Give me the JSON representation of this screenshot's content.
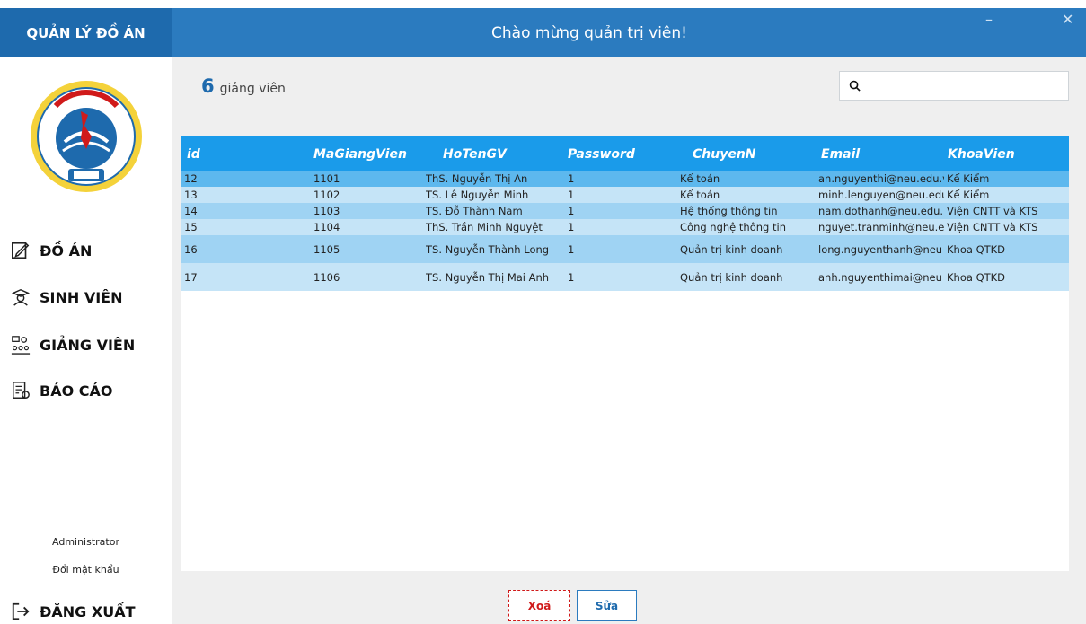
{
  "app": {
    "brand": "QUẢN LÝ ĐỒ ÁN",
    "welcome": "Chào mừng quản trị viên!",
    "minimize": "–",
    "close": "✕"
  },
  "sidebar": {
    "items": [
      {
        "label": "ĐỒ ÁN",
        "icon": "edit-note-icon"
      },
      {
        "label": "SINH VIÊN",
        "icon": "graduate-icon"
      },
      {
        "label": "GIẢNG VIÊN",
        "icon": "teacher-icon"
      },
      {
        "label": "BÁO CÁO",
        "icon": "report-icon"
      }
    ],
    "user": "Administrator",
    "change_password": "Đổi mật khẩu",
    "logout": "ĐĂNG XUẤT"
  },
  "summary": {
    "count": "6",
    "label": "giảng viên"
  },
  "search": {
    "value": "",
    "placeholder": ""
  },
  "table": {
    "columns": [
      "id",
      "MaGiangVien",
      "HoTenGV",
      "Password",
      "ChuyenN",
      "Email",
      "KhoaVien"
    ],
    "rows": [
      [
        "12",
        "1101",
        "ThS. Nguyễn Thị An",
        "1",
        "Kế toán",
        "an.nguyenthi@neu.edu.v",
        "Kế Kiểm"
      ],
      [
        "13",
        "1102",
        "TS. Lê Nguyễn Minh",
        "1",
        "Kế toán",
        "minh.lenguyen@neu.edu",
        "Kế Kiểm"
      ],
      [
        "14",
        "1103",
        "TS. Đỗ Thành Nam",
        "1",
        "Hệ thống thông tin",
        "nam.dothanh@neu.edu.",
        "Viện CNTT và KTS"
      ],
      [
        "15",
        "1104",
        "ThS. Trần Minh Nguyệt",
        "1",
        "Công nghệ thông tin",
        "nguyet.tranminh@neu.e",
        "Viện CNTT và KTS"
      ],
      [
        "16",
        "1105",
        "TS. Nguyễn Thành Long",
        "1",
        "Quản trị kinh doanh",
        "long.nguyenthanh@neu",
        "Khoa QTKD"
      ],
      [
        "17",
        "1106",
        "TS. Nguyễn Thị Mai Anh",
        "1",
        "Quản trị kinh doanh",
        "anh.nguyenthimai@neu",
        "Khoa QTKD"
      ]
    ]
  },
  "actions": {
    "delete": "Xoá",
    "edit": "Sửa"
  },
  "colors": {
    "header": "#2b7bbf",
    "brand": "#1e6aad",
    "table_header": "#1a9bea",
    "delete": "#d01a1a"
  }
}
